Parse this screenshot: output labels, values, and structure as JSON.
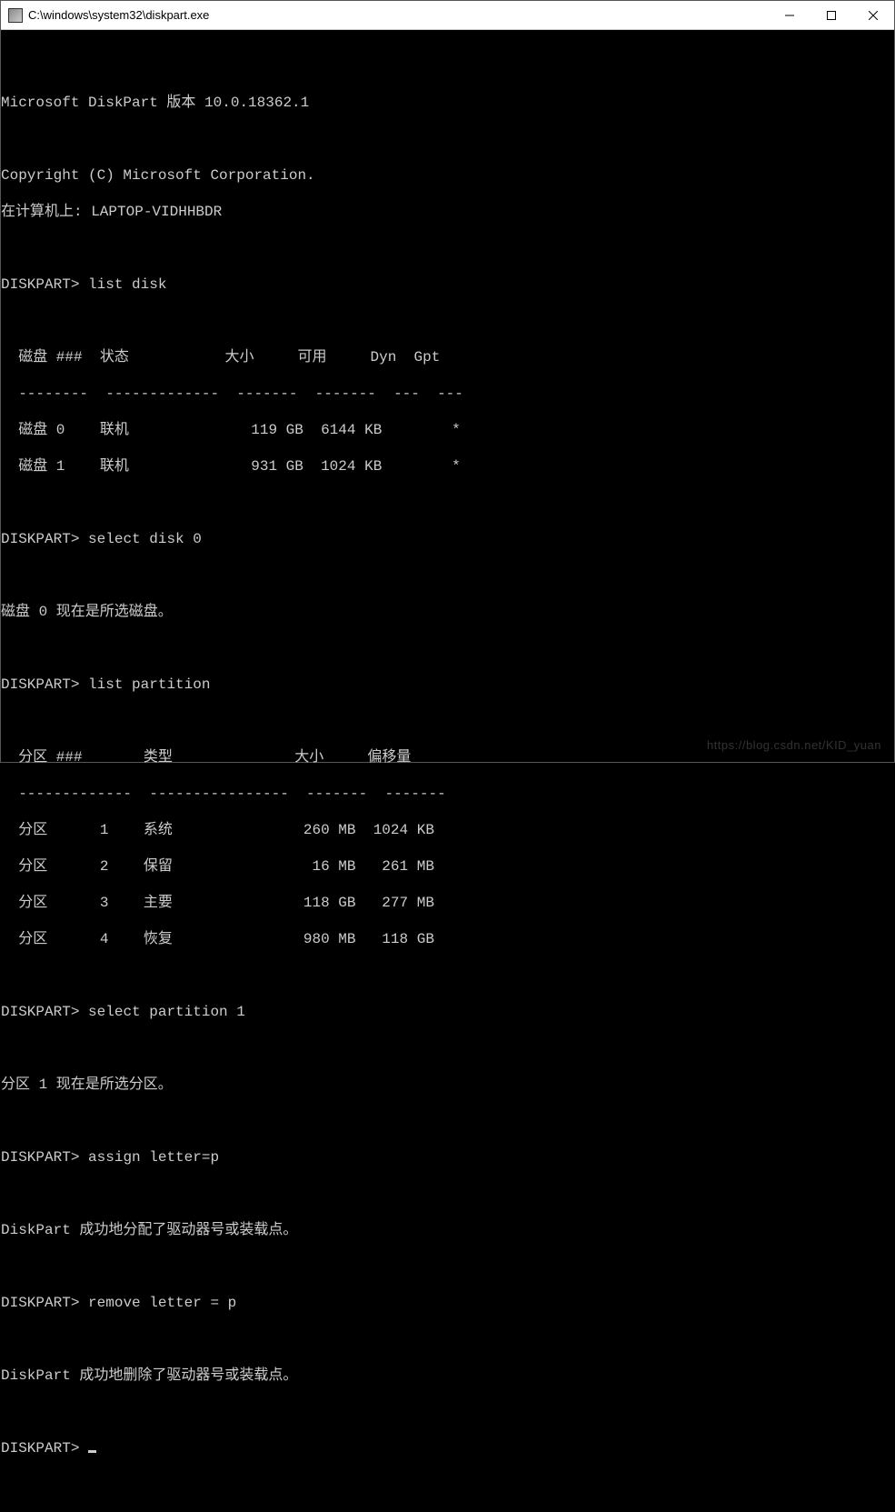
{
  "window": {
    "title": "C:\\windows\\system32\\diskpart.exe"
  },
  "header": {
    "version_line": "Microsoft DiskPart 版本 10.0.18362.1",
    "copyright": "Copyright (C) Microsoft Corporation.",
    "computer_line": "在计算机上: LAPTOP-VIDHHBDR"
  },
  "prompt": "DISKPART>",
  "commands": {
    "cmd1": "list disk",
    "cmd2": "select disk 0",
    "cmd3": "list partition",
    "cmd4": "select partition 1",
    "cmd5": "assign letter=p",
    "cmd6": "remove letter = p"
  },
  "disk_table": {
    "header": {
      "c1": "磁盘 ###",
      "c2": "状态",
      "c3": "大小",
      "c4": "可用",
      "c5": "Dyn",
      "c6": "Gpt"
    },
    "rows": [
      {
        "disk": "磁盘 0",
        "status": "联机",
        "size": "119 GB",
        "free": "6144 KB",
        "dyn": "",
        "gpt": "*"
      },
      {
        "disk": "磁盘 1",
        "status": "联机",
        "size": "931 GB",
        "free": "1024 KB",
        "dyn": "",
        "gpt": "*"
      }
    ]
  },
  "responses": {
    "disk_selected": "磁盘 0 现在是所选磁盘。",
    "partition_selected": "分区 1 现在是所选分区。",
    "assign_ok": "DiskPart 成功地分配了驱动器号或装载点。",
    "remove_ok": "DiskPart 成功地删除了驱动器号或装载点。"
  },
  "partition_table": {
    "header": {
      "c1": "分区 ###",
      "c2": "类型",
      "c3": "大小",
      "c4": "偏移量"
    },
    "rows": [
      {
        "part": "分区",
        "num": "1",
        "type": "系统",
        "size": "260 MB",
        "offset": "1024 KB"
      },
      {
        "part": "分区",
        "num": "2",
        "type": "保留",
        "size": " 16 MB",
        "offset": " 261 MB"
      },
      {
        "part": "分区",
        "num": "3",
        "type": "主要",
        "size": "118 GB",
        "offset": " 277 MB"
      },
      {
        "part": "分区",
        "num": "4",
        "type": "恢复",
        "size": "980 MB",
        "offset": " 118 GB"
      }
    ]
  },
  "watermark": "https://blog.csdn.net/KID_yuan"
}
